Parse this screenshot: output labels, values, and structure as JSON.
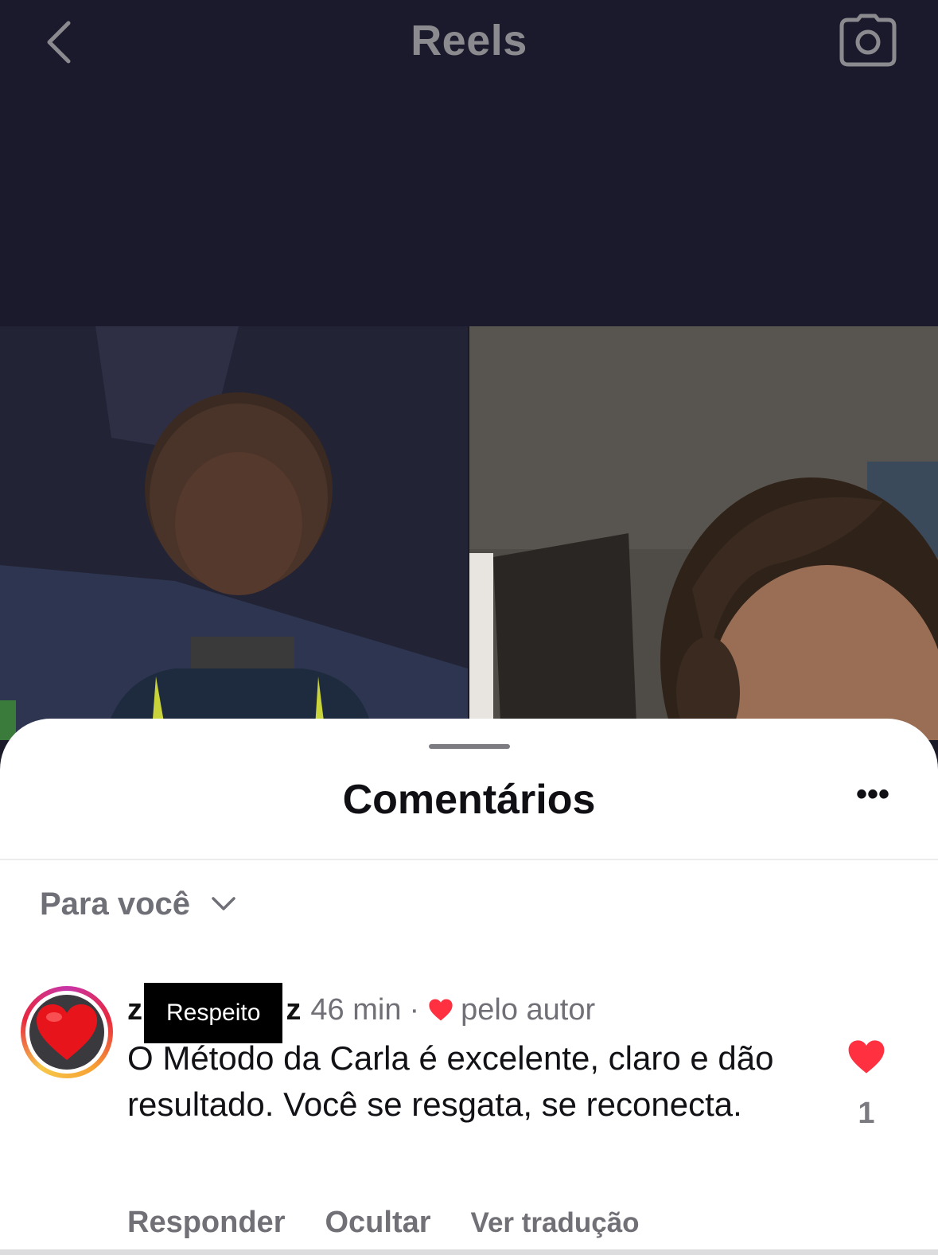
{
  "header": {
    "title": "Reels",
    "back_icon": "chevron-left-icon",
    "camera_icon": "camera-icon"
  },
  "sheet": {
    "title": "Comentários",
    "more_label": "•••"
  },
  "filter": {
    "label": "Para você",
    "icon": "chevron-down-icon"
  },
  "comment": {
    "username_start": "z",
    "username_redaction": "Respeito",
    "username_end": "z",
    "time": "46 min",
    "separator": "·",
    "author_like": "pelo autor",
    "text": "O Método da Carla é excelente, claro e dão resultado. Você se resgata, se reconecta.",
    "like_count": "1",
    "actions": {
      "reply": "Responder",
      "hide": "Ocultar",
      "translate": "Ver tradução"
    }
  },
  "colors": {
    "like_red": "#ff3040",
    "header_bg": "#1b1a2c",
    "muted_text": "#707076"
  }
}
